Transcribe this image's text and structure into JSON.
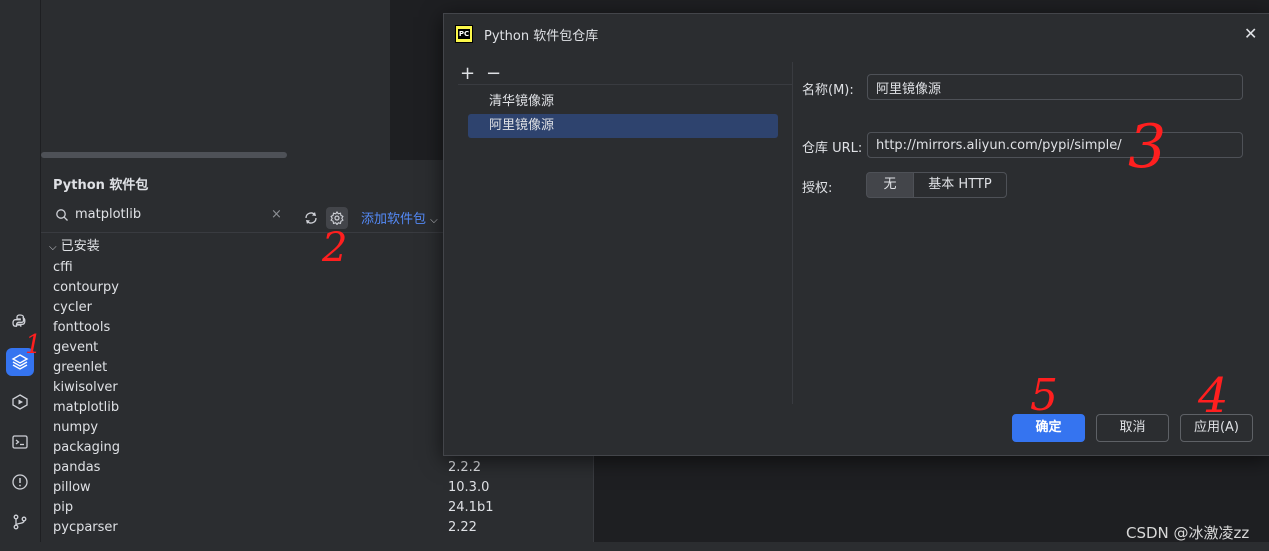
{
  "packages": {
    "title": "Python 软件包",
    "search_value": "matplotlib",
    "clear_glyph": "×",
    "add_label": "添加软件包",
    "installed_label": "已安装",
    "items": [
      "cffi",
      "contourpy",
      "cycler",
      "fonttools",
      "gevent",
      "greenlet",
      "kiwisolver",
      "matplotlib",
      "numpy",
      "packaging",
      "pandas",
      "pillow",
      "pip",
      "pycparser"
    ],
    "versions": [
      "2.2.2",
      "10.3.0",
      "24.1b1",
      "2.22"
    ]
  },
  "dialog": {
    "title": "Python 软件包仓库",
    "close_glyph": "✕",
    "add_glyph": "+",
    "remove_glyph": "−",
    "repos": [
      "清华镜像源",
      "阿里镜像源"
    ],
    "selected_repo_index": 1,
    "name_label": "名称(M):",
    "name_value": "阿里镜像源",
    "url_label": "仓库 URL:",
    "url_value": "http://mirrors.aliyun.com/pypi/simple/",
    "auth_label": "授权:",
    "auth_none": "无",
    "auth_basic": "基本 HTTP",
    "ok_label": "确定",
    "cancel_label": "取消",
    "apply_label": "应用(A)"
  },
  "annotations": {
    "one": "1",
    "two": "2",
    "three": "3",
    "four": "4",
    "five": "5"
  },
  "watermark": "CSDN @冰激凌zz",
  "colors": {
    "accent": "#3574f0",
    "selection": "#2e436e",
    "annotation": "#ff1f1f",
    "link": "#548af7"
  }
}
